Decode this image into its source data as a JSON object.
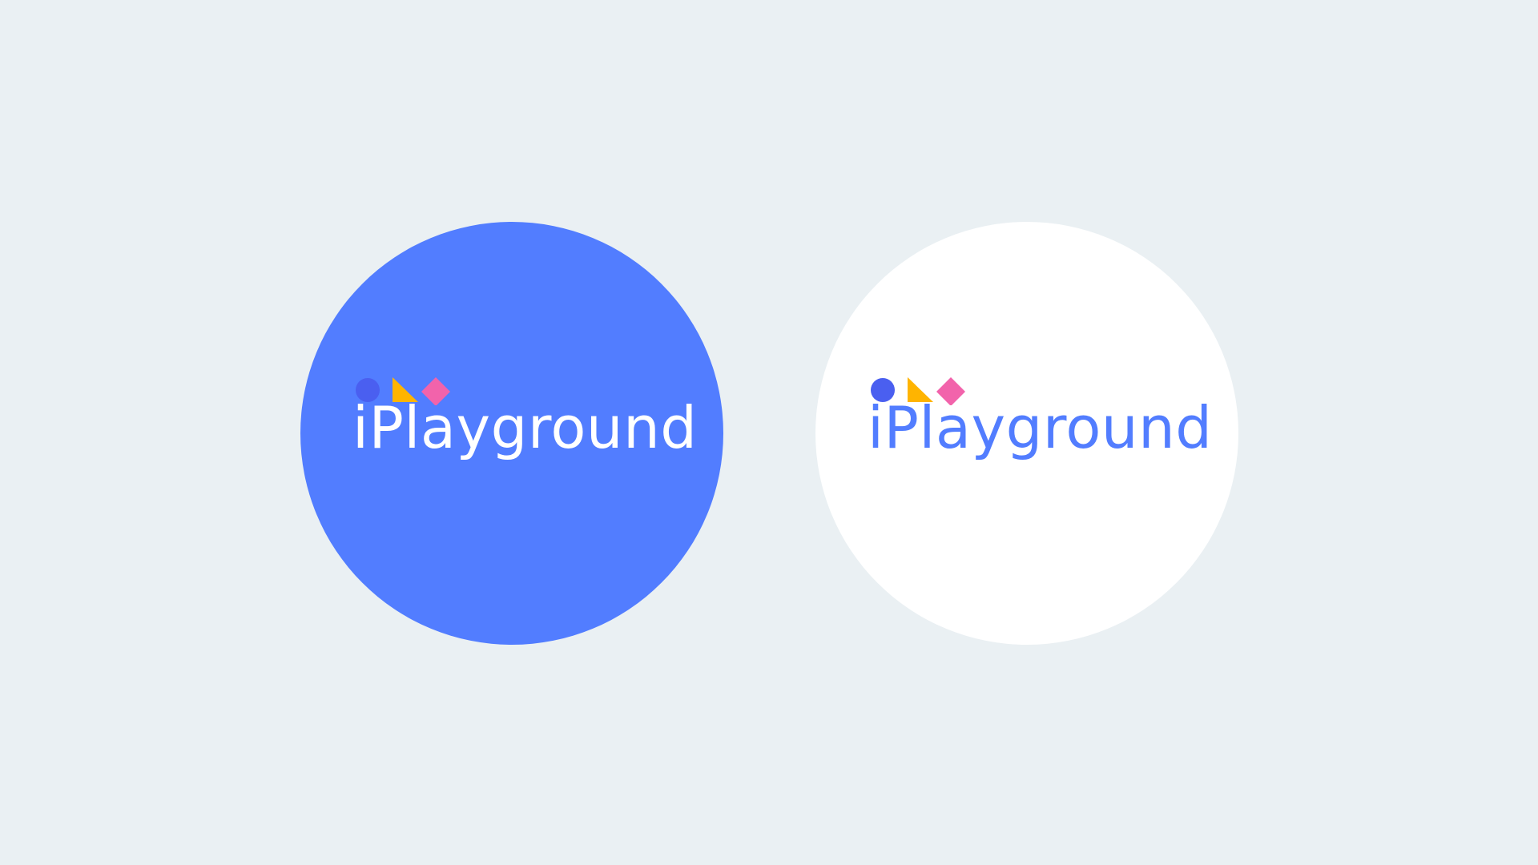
{
  "logos": [
    {
      "variant": "on-blue",
      "wordmark": "iPlayground",
      "background_color": "#527dff",
      "text_color": "#ffffff"
    },
    {
      "variant": "on-white",
      "wordmark": "iPlayground",
      "background_color": "#ffffff",
      "text_color": "#527dff"
    }
  ],
  "page_background": "#eaf0f3",
  "shape_colors": {
    "circle": "#4a5ff0",
    "triangle": "#ffb400",
    "diamond": "#f263ab"
  },
  "icons": [
    "circle-icon",
    "triangle-icon",
    "diamond-icon"
  ]
}
